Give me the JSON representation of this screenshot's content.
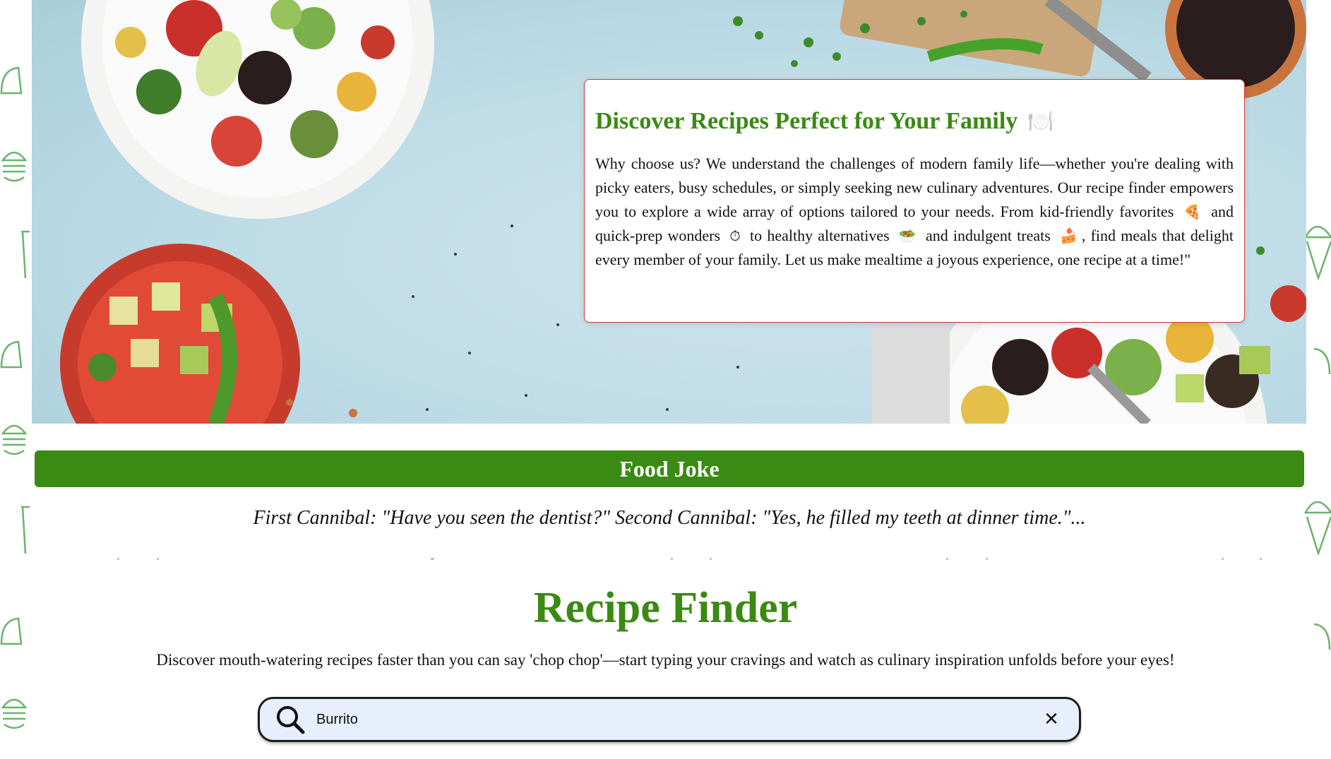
{
  "intro": {
    "title": "Discover Recipes Perfect for Your Family",
    "title_icon": "🍽️",
    "text_1": "Why choose us? We understand the challenges of modern family life—whether you're dealing with picky eaters, busy schedules, or simply seeking new culinary adventures. Our recipe finder empowers you to explore a wide array of options tailored to your needs. From kid-friendly favorites",
    "emoji_1": "🍕",
    "text_2": "and quick-prep wonders",
    "emoji_2": "⏱",
    "text_3": "to healthy alternatives",
    "emoji_3": "🥗",
    "text_4": "and indulgent treats",
    "emoji_4": "🍰",
    "text_5": ", find meals that delight every member of your family. Let us make mealtime a joyous experience, one recipe at a time!\""
  },
  "joke": {
    "heading": "Food Joke",
    "text": "First Cannibal: \"Have you seen the dentist?\" Second Cannibal: \"Yes, he filled my teeth at dinner time.\"..."
  },
  "finder": {
    "title": "Recipe Finder",
    "subtitle": "Discover mouth-watering recipes faster than you can say 'chop chop'—start typing your cravings and watch as culinary inspiration unfolds before your eyes!",
    "search_value": "Burrito",
    "clear_label": "✕"
  },
  "colors": {
    "brand_green": "#3a8a13",
    "card_border": "#d33a3a",
    "search_bg": "#e6effb"
  }
}
